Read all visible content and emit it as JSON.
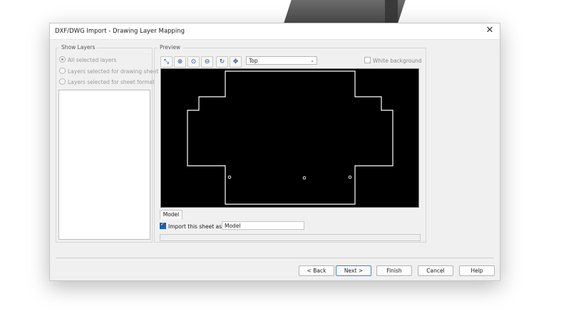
{
  "window": {
    "title": "DXF/DWG Import - Drawing Layer Mapping",
    "close_glyph": "✕"
  },
  "show_layers": {
    "label": "Show Layers",
    "options": [
      {
        "label": "All selected layers",
        "selected": true
      },
      {
        "label": "Layers selected for drawing sheet",
        "selected": false
      },
      {
        "label": "Layers selected for sheet format",
        "selected": false
      }
    ]
  },
  "preview": {
    "label": "Preview",
    "toolbar": [
      {
        "name": "select-icon",
        "glyph": "⤡"
      },
      {
        "name": "zoom-window-icon",
        "glyph": "⊕"
      },
      {
        "name": "zoom-fit-icon",
        "glyph": "⊙"
      },
      {
        "name": "zoom-out-icon",
        "glyph": "⊖"
      },
      {
        "name": "rotate-icon",
        "glyph": "↻"
      },
      {
        "name": "pan-icon",
        "glyph": "✥"
      }
    ],
    "view": "Top",
    "white_background": "White background",
    "tab": "Model",
    "import_label": "Import this sheet as :",
    "import_checked": true,
    "sheet_name": "Model"
  },
  "buttons": {
    "back": "< Back",
    "next": "Next >",
    "finish": "Finish",
    "cancel": "Cancel",
    "help": "Help"
  },
  "colors": {
    "accent": "#1e5fb0",
    "canvas": "#000000",
    "outline": "#ffffff"
  }
}
